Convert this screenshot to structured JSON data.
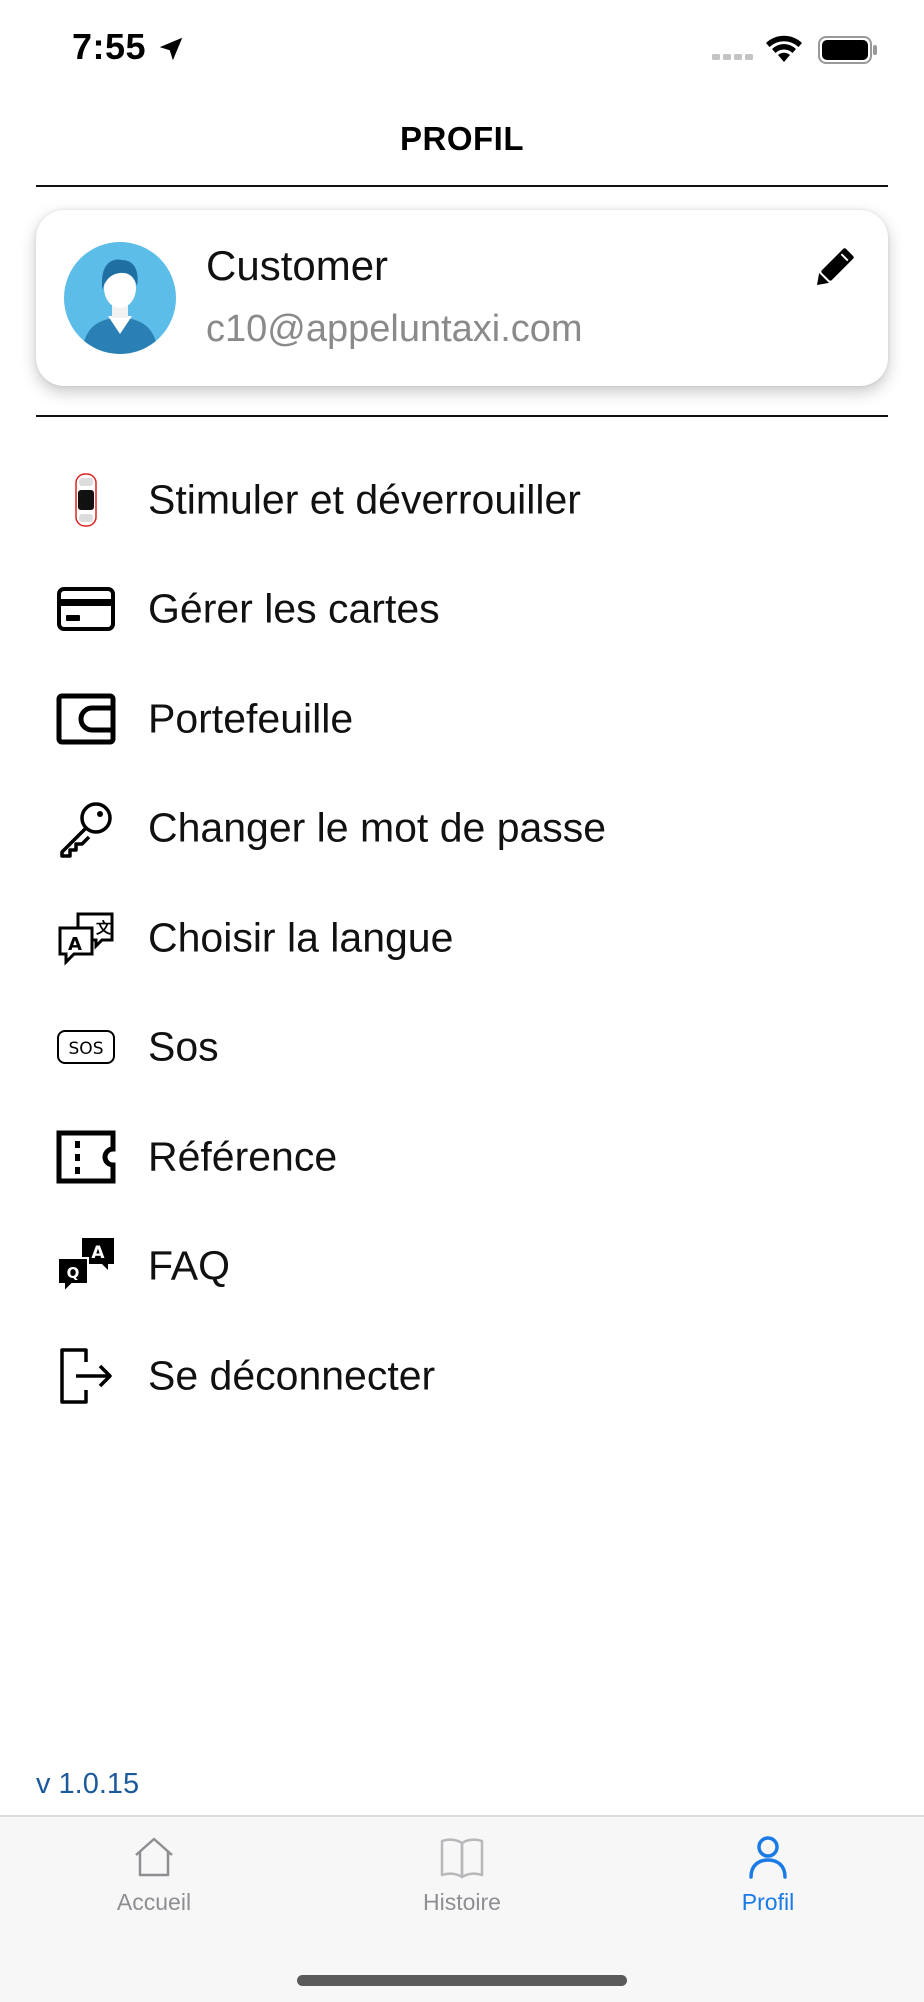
{
  "status_bar": {
    "time": "7:55",
    "icons": [
      "location-arrow-icon",
      "signal-icon",
      "wifi-icon",
      "battery-icon"
    ]
  },
  "header": {
    "title": "PROFIL"
  },
  "profile": {
    "name": "Customer",
    "email": "c10@appeluntaxi.com",
    "avatar_icon": "user-avatar-icon",
    "edit_icon": "pencil-icon"
  },
  "menu": {
    "items": [
      {
        "label": "Stimuler et déverrouiller",
        "icon": "car-icon"
      },
      {
        "label": "Gérer les cartes",
        "icon": "credit-card-icon"
      },
      {
        "label": "Portefeuille",
        "icon": "wallet-icon"
      },
      {
        "label": "Changer le mot de passe",
        "icon": "key-icon"
      },
      {
        "label": "Choisir la langue",
        "icon": "language-icon"
      },
      {
        "label": "Sos",
        "icon": "sos-icon"
      },
      {
        "label": "Référence",
        "icon": "ticket-icon"
      },
      {
        "label": "FAQ",
        "icon": "faq-icon"
      },
      {
        "label": "Se déconnecter",
        "icon": "logout-icon"
      }
    ]
  },
  "version": "v 1.0.15",
  "tab_bar": {
    "tabs": [
      {
        "label": "Accueil",
        "icon": "home-icon",
        "active": false
      },
      {
        "label": "Histoire",
        "icon": "book-icon",
        "active": false
      },
      {
        "label": "Profil",
        "icon": "person-icon",
        "active": true
      }
    ]
  },
  "colors": {
    "accent": "#1a7ae6",
    "version_text": "#1c5a9c",
    "muted_text": "#8a8a8a",
    "tab_inactive": "#8e8e93"
  }
}
